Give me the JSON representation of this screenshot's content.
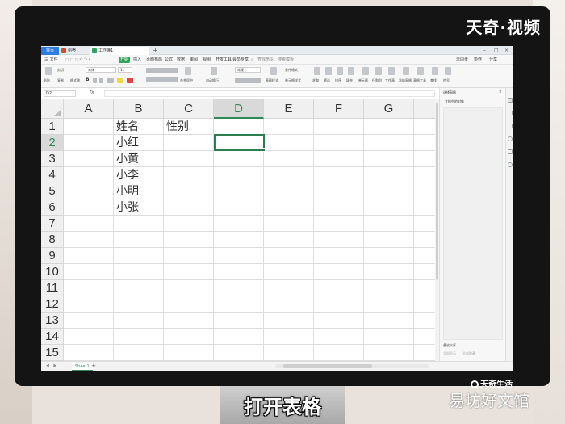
{
  "watermark": "天奇·视频",
  "window": {
    "tabs": [
      {
        "label": "首页"
      },
      {
        "label": "稻壳"
      },
      {
        "label": "工作簿1"
      }
    ],
    "new_tab": "+"
  },
  "menu": {
    "file": "三 文件",
    "items": [
      "开始",
      "插入",
      "页面布局",
      "公式",
      "数据",
      "审阅",
      "视图",
      "开发工具",
      "会员专享"
    ],
    "search": "查找命令、搜索模板",
    "right": [
      "未同步",
      "协作",
      "分享"
    ]
  },
  "ribbon": {
    "paste": "粘贴",
    "cut": "剪切",
    "copy": "复制",
    "format_painter": "格式刷",
    "font_name": "宋体",
    "font_size": "11",
    "bold": "B",
    "merge": "合并居中",
    "wrap": "自动换行",
    "number_format": "常规",
    "conditional": "条件格式",
    "table_style": "表格样式",
    "cell_style": "单元格样式",
    "sum": "求和",
    "filter": "筛选",
    "sort": "排序",
    "fill": "填充",
    "cells": "单元格",
    "rows_cols": "行和列",
    "worksheet": "工作表",
    "freeze": "冻结窗格",
    "table_tools": "表格工具",
    "find": "查找",
    "symbol": "符号"
  },
  "formula_bar": {
    "name_box": "D2",
    "fx": "fx"
  },
  "sheet": {
    "columns": [
      "A",
      "B",
      "C",
      "D",
      "E",
      "F",
      "G"
    ],
    "rows": [
      "1",
      "2",
      "3",
      "4",
      "5",
      "6",
      "7",
      "8",
      "9",
      "10",
      "11",
      "12",
      "13",
      "14",
      "15"
    ],
    "active_column": "D",
    "active_row": "2",
    "cells": {
      "B1": "姓名",
      "C1": "性别",
      "B2": "小红",
      "B3": "小黄",
      "B4": "小李",
      "B5": "小明",
      "B6": "小张"
    }
  },
  "side_panel": {
    "title": "选择窗格",
    "subtitle": "文档中的对象",
    "show_all": "全部显示",
    "hide_all": "全部隐藏",
    "layer_order": "叠放次序"
  },
  "status": {
    "sheet_tab": "Sheet1",
    "add_sheet": "+",
    "nav": "◀ ▶"
  },
  "caption": "打开表格",
  "brand": "天奇生活",
  "site_watermark": "易坊好文馆"
}
